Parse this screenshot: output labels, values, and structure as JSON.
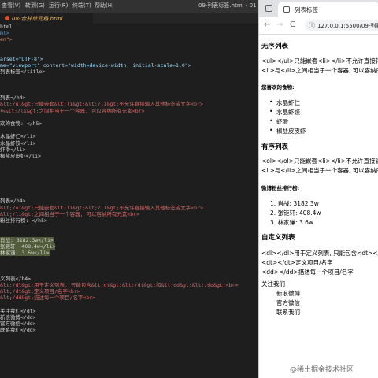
{
  "editor": {
    "menu": [
      "查看(V)",
      "转到(G)",
      "运行(R)",
      "终端(T)",
      "帮助(H)"
    ],
    "window_title": "09-列表标签.html - 01",
    "tab_label": "08-合并单元格.html",
    "lines": [
      {
        "t": "html",
        "c": "txt"
      },
      {
        "t": "ml>",
        "c": "tag"
      },
      {
        "t": "en\">",
        "c": "str"
      },
      {
        "t": "",
        "c": "txt"
      },
      {
        "t": "",
        "c": "txt"
      },
      {
        "t": "arset=\"UTF-8\">",
        "c": "att"
      },
      {
        "t": "me=\"viewport\" content=\"width=device-width, initial-scale=1.0\">",
        "c": "att"
      },
      {
        "t": "列表标签</title>",
        "c": "txt"
      },
      {
        "t": "",
        "c": "txt"
      },
      {
        "t": "",
        "c": "txt"
      },
      {
        "t": "",
        "c": "txt"
      },
      {
        "t": "列表</h4>",
        "c": "txt"
      },
      {
        "t": "&lt;/ul&gt;只能嵌套&lt;li&gt;&lt;/li&gt;不允许直接输入其他标签或文字<br>",
        "c": "ent"
      },
      {
        "t": "与&lt;/li&gt;之间相当于一个容器, 可以容纳所有元素<br>",
        "c": "ent"
      },
      {
        "t": "",
        "c": "txt"
      },
      {
        "t": "欢的食物: </h5>",
        "c": "txt"
      },
      {
        "t": "",
        "c": "txt"
      },
      {
        "t": "水晶虾仁</li>",
        "c": "txt"
      },
      {
        "t": "水晶虾饺</li>",
        "c": "txt"
      },
      {
        "t": "虾滑</li>",
        "c": "txt"
      },
      {
        "t": "椒盐皮皮虾</li>",
        "c": "txt"
      },
      {
        "t": "",
        "c": "txt"
      },
      {
        "t": "",
        "c": "txt"
      },
      {
        "t": "",
        "c": "txt"
      },
      {
        "t": "",
        "c": "txt"
      },
      {
        "t": "",
        "c": "txt"
      },
      {
        "t": "",
        "c": "txt"
      },
      {
        "t": "列表</h4>",
        "c": "txt"
      },
      {
        "t": "&lt;/ol&gt;只能嵌套&lt;li&gt;&lt;/li&gt;不允许直接输入其他标签或文字<br>",
        "c": "ent"
      },
      {
        "t": "&lt;/li&gt;之间相当于一个容器, 可以容纳所有元素<br>",
        "c": "ent"
      },
      {
        "t": "粉丝排行榜: </h5>",
        "c": "txt"
      },
      {
        "t": "",
        "c": "txt"
      },
      {
        "t": "",
        "c": "txt"
      },
      {
        "t": "肖战: 3182.3w</li>",
        "c": "txt",
        "hl": true
      },
      {
        "t": "张钜轩: 408.4w</li>",
        "c": "txt",
        "hl": true
      },
      {
        "t": "林家谦: 3.6w</li>",
        "c": "txt",
        "hl": true
      },
      {
        "t": "",
        "c": "txt"
      },
      {
        "t": "",
        "c": "txt"
      },
      {
        "t": "",
        "c": "txt"
      },
      {
        "t": "义列表</h4>",
        "c": "txt"
      },
      {
        "t": "&lt;/dl&gt;用于定义列表, 只能包含&lt;dt&gt;&lt;/dt&gt;和&lt;dd&gt;&lt;/dd&gt;<br>",
        "c": "ent"
      },
      {
        "t": "&lt;/dt&gt;定义项目/名字<br>",
        "c": "ent"
      },
      {
        "t": "&lt;/dd&gt;描述每一个项目/名字<br>",
        "c": "ent"
      },
      {
        "t": "",
        "c": "txt"
      },
      {
        "t": "关注我们</dt>",
        "c": "txt"
      },
      {
        "t": "新浪微博</dd>",
        "c": "txt"
      },
      {
        "t": "官方微信</dd>",
        "c": "txt"
      },
      {
        "t": "联系我们</dd>",
        "c": "txt"
      }
    ]
  },
  "browser": {
    "tab_title": "列表标签",
    "url": "127.0.0.1:5500/09-列表标签",
    "nav": {
      "back": "←",
      "forward": "→",
      "reload": "C"
    },
    "info_icon": "ⓘ"
  },
  "page": {
    "ul_heading": "无序列表",
    "ul_desc1": "<ul></ul>只能嵌套<li></li>不允许直接输入其他标签或文字",
    "ul_desc2": "<li>与</li>之间相当于一个容器, 可以容纳所有元素",
    "ul_subheading": "您喜欢的食物:",
    "ul_items": [
      "水晶虾仁",
      "水晶虾饺",
      "虾滑",
      "椒盐皮皮虾"
    ],
    "ol_heading": "有序列表",
    "ol_desc1": "<ol></ol>只能嵌套<li></li>不允许直接输入其他标签或文字",
    "ol_desc2": "<li>与</li>之间相当于一个容器, 可以容纳所有元素",
    "ol_subheading": "微博粉丝排行榜:",
    "ol_items": [
      "1. 肖战: 3182.3w",
      "2. 张钜轩: 408.4w",
      "3. 林家谦: 3.6w"
    ],
    "dl_heading": "自定义列表",
    "dl_desc1": "<dl></dl>用于定义列表, 只能包含<dt></dt>和<dd></dd>",
    "dl_desc2": "<dt></dt>定义项目/名字",
    "dl_desc3": "<dd></dd>描述每一个项目/名字",
    "dl_term": "关注我们",
    "dl_items": [
      "新浪微博",
      "官方微信",
      "联系我们"
    ]
  },
  "watermark": "@稀土掘金技术社区"
}
